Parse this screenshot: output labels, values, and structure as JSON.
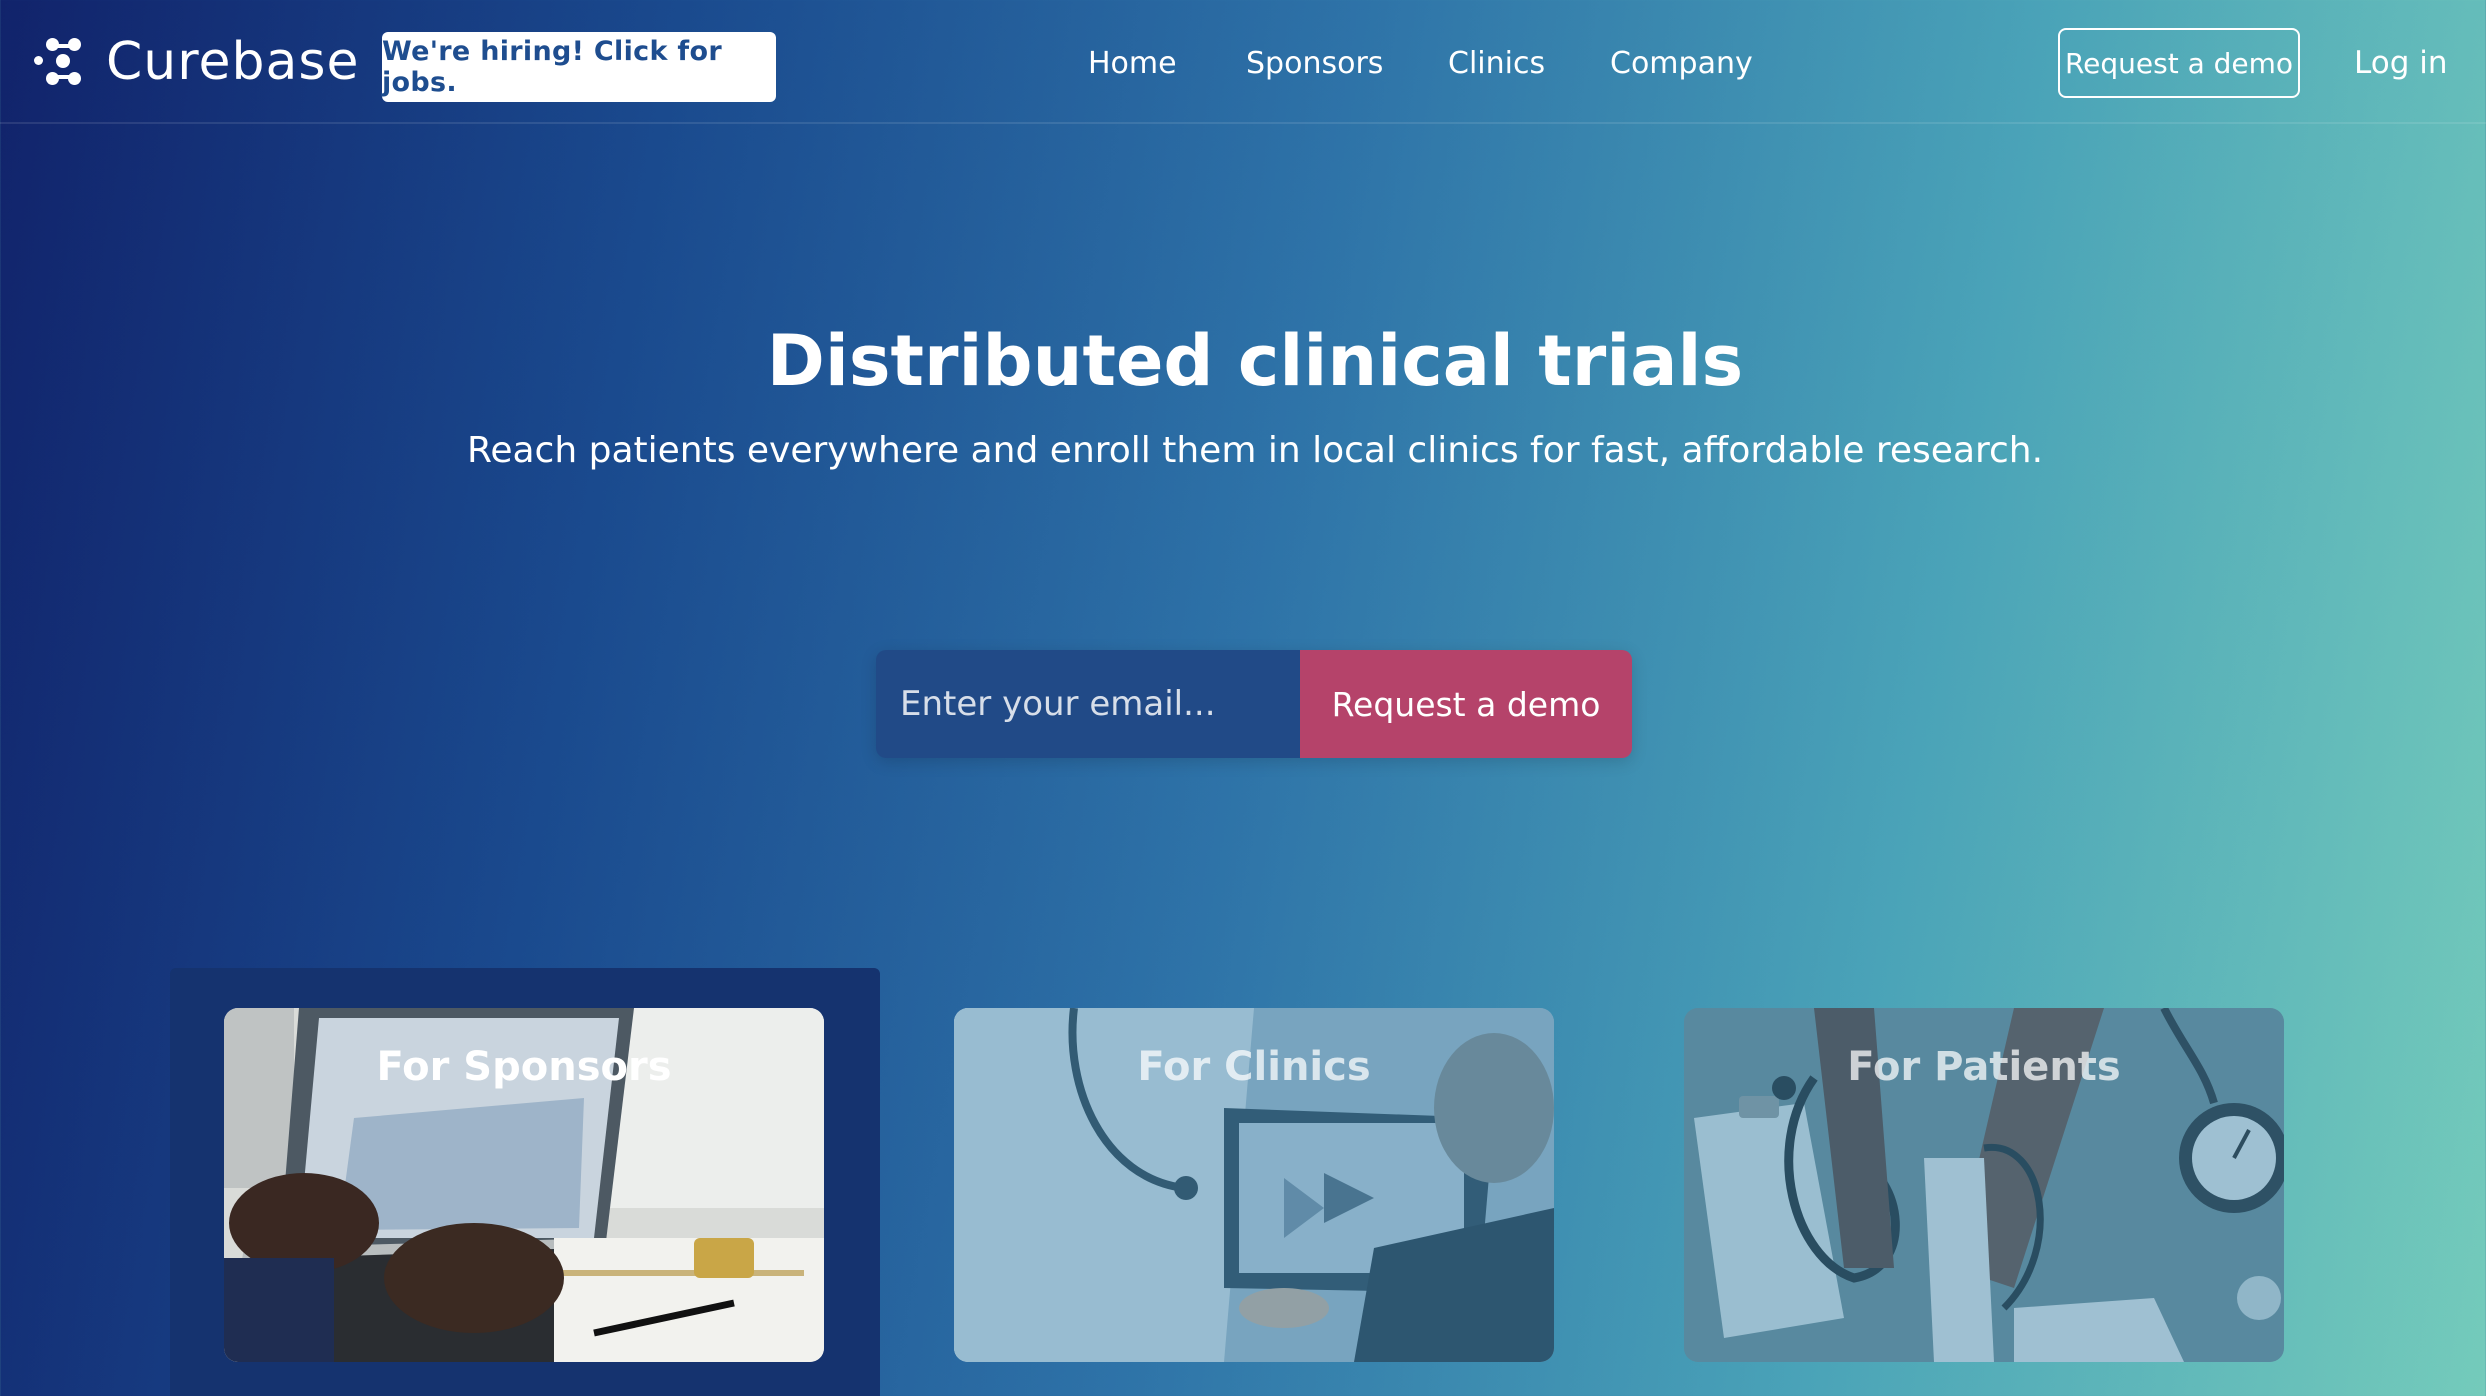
{
  "brand": {
    "name": "Curebase"
  },
  "header": {
    "hiring_label": "We're hiring! Click for jobs.",
    "nav": [
      "Home",
      "Sponsors",
      "Clinics",
      "Company"
    ],
    "demo_label": "Request a demo",
    "login_label": "Log in"
  },
  "hero": {
    "title": "Distributed clinical trials",
    "subtitle": "Reach patients everywhere and enroll them in local clinics for fast, affordable research.",
    "email_placeholder": "Enter your email...",
    "cta_label": "Request a demo"
  },
  "cards": [
    {
      "title": "For Sponsors",
      "active": true
    },
    {
      "title": "For Clinics",
      "active": false
    },
    {
      "title": "For Patients",
      "active": false
    }
  ],
  "colors": {
    "gradient_start": "#11236b",
    "gradient_end": "#74cbbb",
    "cta": "#b5436a",
    "hiring_text": "#1e4d8f",
    "active_card_bg": "#15336f"
  }
}
